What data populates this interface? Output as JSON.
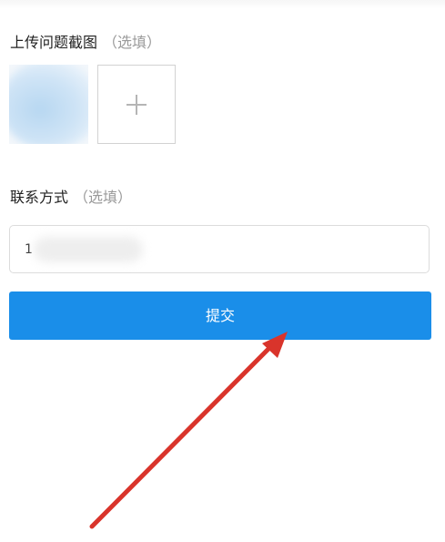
{
  "upload_section": {
    "title": "上传问题截图",
    "optional": "（选填）"
  },
  "contact_section": {
    "title": "联系方式",
    "optional": "（选填）",
    "field_value": "1"
  },
  "submit_button": {
    "label": "提交"
  },
  "colors": {
    "primary": "#1a8ee9",
    "annotation_arrow": "#d9342b"
  },
  "icons": [
    "plus-icon",
    "annotation-arrow"
  ]
}
